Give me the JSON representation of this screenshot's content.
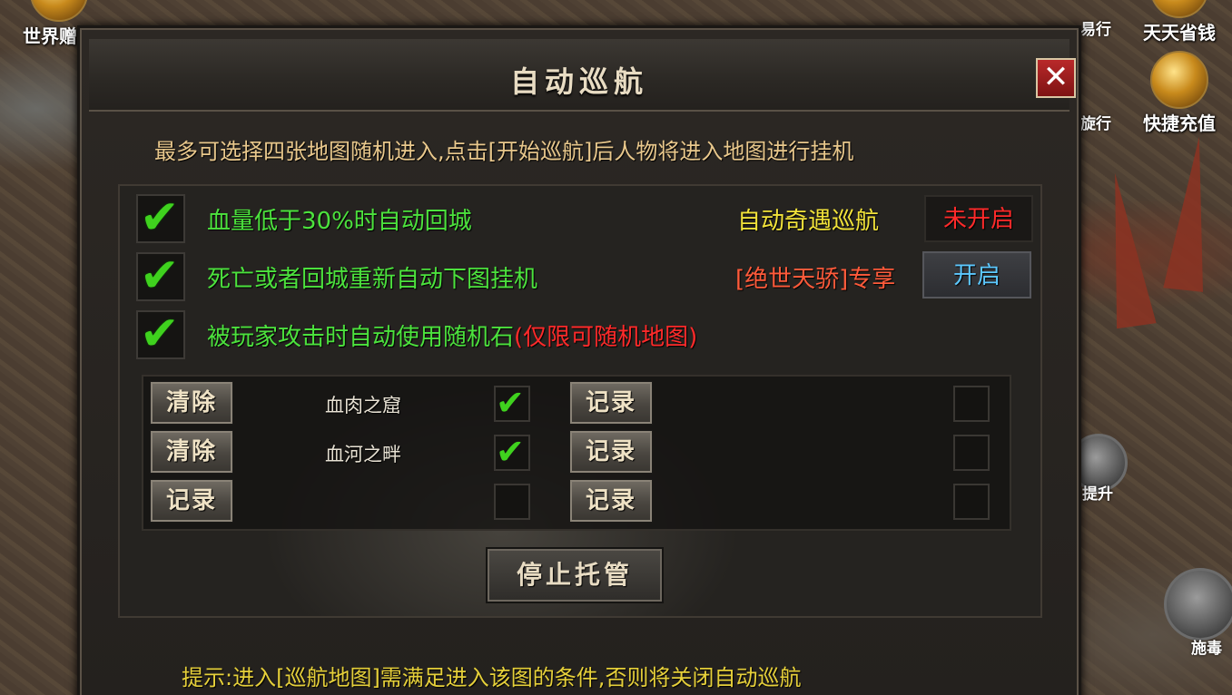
{
  "hud": {
    "top_left_label": "世界赠福",
    "top_right_labels": [
      "天天省钱",
      "快捷充值"
    ],
    "partial_labels": [
      "易行",
      "旋行",
      "提升",
      "施毒"
    ]
  },
  "dialog": {
    "title": "自动巡航",
    "description": "最多可选择四张地图随机进入,点击[开始巡航]后人物将进入地图进行挂机",
    "options": [
      {
        "label": "血量低于30%时自动回城",
        "checked": true
      },
      {
        "label": "死亡或者回城重新自动下图挂机",
        "checked": true
      },
      {
        "label": "被玩家攻击时自动使用随机石",
        "warning": "(仅限可随机地图)",
        "checked": true
      }
    ],
    "auto_encounter": {
      "label": "自动奇遇巡航",
      "status": "未开启"
    },
    "exclusive": {
      "bracket": "[绝世天骄]",
      "label": "专享",
      "button": "开启"
    },
    "slots_left": [
      {
        "button": "清除",
        "map": "血肉之窟",
        "checked": true
      },
      {
        "button": "清除",
        "map": "血河之畔",
        "checked": true
      },
      {
        "button": "记录",
        "map": "",
        "checked": false
      }
    ],
    "slots_right": [
      {
        "button": "记录",
        "checked": false
      },
      {
        "button": "记录",
        "checked": false
      },
      {
        "button": "记录",
        "checked": false
      }
    ],
    "stop_button": "停止托管",
    "tip": "提示:进入[巡航地图]需满足进入该图的条件,否则将关闭自动巡航",
    "close_icon": "close-icon"
  },
  "colors": {
    "option_green": "#4ce23d",
    "warning_red": "#ff2a2a",
    "gold": "#e9c88c",
    "tip_yellow": "#e6d03a"
  }
}
